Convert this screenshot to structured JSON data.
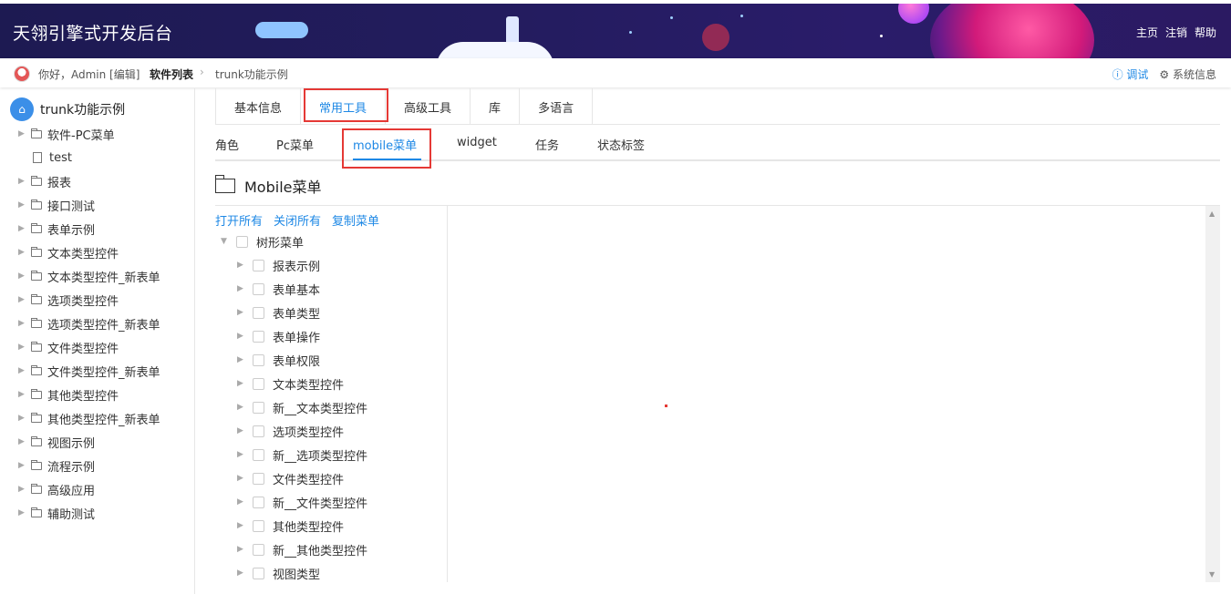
{
  "header": {
    "title": "天翎引擎式开发后台",
    "links": [
      "主页",
      "注销",
      "帮助"
    ]
  },
  "breadcrumb": {
    "greeting": "你好，Admin [编辑]",
    "crumb": "软件列表",
    "current": "trunk功能示例",
    "debug": "调试",
    "sysinfo": "系统信息"
  },
  "left_tree": {
    "root": "trunk功能示例",
    "items": [
      {
        "label": "软件-PC菜单",
        "type": "folder"
      },
      {
        "label": "test",
        "type": "doc"
      },
      {
        "label": "报表",
        "type": "folder"
      },
      {
        "label": "接口测试",
        "type": "folder"
      },
      {
        "label": "表单示例",
        "type": "folder"
      },
      {
        "label": "文本类型控件",
        "type": "folder"
      },
      {
        "label": "文本类型控件_新表单",
        "type": "folder"
      },
      {
        "label": "选项类型控件",
        "type": "folder"
      },
      {
        "label": "选项类型控件_新表单",
        "type": "folder"
      },
      {
        "label": "文件类型控件",
        "type": "folder"
      },
      {
        "label": "文件类型控件_新表单",
        "type": "folder"
      },
      {
        "label": "其他类型控件",
        "type": "folder"
      },
      {
        "label": "其他类型控件_新表单",
        "type": "folder"
      },
      {
        "label": "视图示例",
        "type": "folder"
      },
      {
        "label": "流程示例",
        "type": "folder"
      },
      {
        "label": "高级应用",
        "type": "folder"
      },
      {
        "label": "辅助测试",
        "type": "folder"
      }
    ]
  },
  "tabs_primary": [
    "基本信息",
    "常用工具",
    "高级工具",
    "库",
    "多语言"
  ],
  "tabs_secondary": [
    "角色",
    "Pc菜单",
    "mobile菜单",
    "widget",
    "任务",
    "状态标签"
  ],
  "section_title": "Mobile菜单",
  "actions": [
    "打开所有",
    "关闭所有",
    "复制菜单"
  ],
  "menu_tree": {
    "root": "树形菜单",
    "items": [
      "报表示例",
      "表单基本",
      "表单类型",
      "表单操作",
      "表单权限",
      "文本类型控件",
      "新__文本类型控件",
      "选项类型控件",
      "新__选项类型控件",
      "文件类型控件",
      "新__文件类型控件",
      "其他类型控件",
      "新__其他类型控件",
      "视图类型"
    ]
  }
}
